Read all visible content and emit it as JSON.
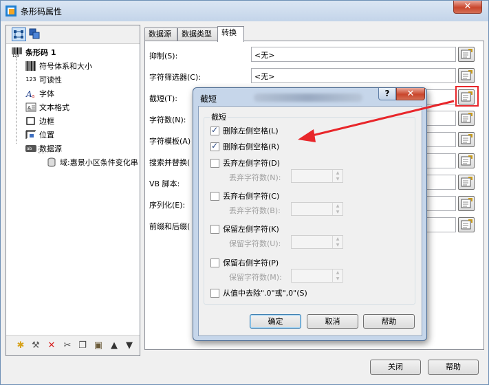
{
  "window": {
    "title": "条形码属性",
    "close_glyph": "✕"
  },
  "tree": {
    "root": "条形码 1",
    "items": [
      {
        "label": "符号体系和大小",
        "icon": "barcode-icon"
      },
      {
        "label": "可读性",
        "icon_text": "123"
      },
      {
        "label": "字体",
        "icon": "font-icon"
      },
      {
        "label": "文本格式",
        "icon": "text-format-icon"
      },
      {
        "label": "边框",
        "icon": "border-icon"
      },
      {
        "label": "位置",
        "icon": "position-icon"
      },
      {
        "label": "数据源",
        "icon": "datasource-icon"
      }
    ],
    "child": "域:惠景小区条件变化串"
  },
  "tabs": [
    "数据源",
    "数据类型",
    "转换"
  ],
  "properties": [
    {
      "label": "抑制(S):",
      "value": "<无>"
    },
    {
      "label": "字符筛选器(C):",
      "value": "<无>"
    },
    {
      "label": "截短(T):",
      "value": ""
    },
    {
      "label": "字符数(N):",
      "value": ""
    },
    {
      "label": "字符模板(A)",
      "value": ""
    },
    {
      "label": "搜索并替换(",
      "value": ""
    },
    {
      "label": "VB 脚本:",
      "value": ""
    },
    {
      "label": "序列化(E):",
      "value": ""
    },
    {
      "label": "前缀和后缀(",
      "value": ""
    }
  ],
  "main_buttons": {
    "close": "关闭",
    "help": "帮助"
  },
  "dialog": {
    "title": "截短",
    "help_glyph": "?",
    "close_glyph": "✕",
    "group_label": "截短",
    "options": [
      {
        "label": "删除左侧空格(L)",
        "checked": true
      },
      {
        "label": "删除右侧空格(R)",
        "checked": true
      },
      {
        "label": "丢弃左侧字符(D)",
        "checked": false,
        "sub_label": "丢弃字符数(N):"
      },
      {
        "label": "丢弃右侧字符(C)",
        "checked": false,
        "sub_label": "丢弃字符数(B):"
      },
      {
        "label": "保留左侧字符(K)",
        "checked": false,
        "sub_label": "保留字符数(U):"
      },
      {
        "label": "保留右侧字符(P)",
        "checked": false,
        "sub_label": "保留字符数(M):"
      },
      {
        "label": "从值中去除\".0\"或\",0\"(S)",
        "checked": false
      }
    ],
    "buttons": {
      "ok": "确定",
      "cancel": "取消",
      "help": "帮助"
    }
  },
  "colors": {
    "annotation": "#e8262a",
    "title_bar": "#c3d4e9",
    "dialog_frame": "#c6d6ea"
  }
}
